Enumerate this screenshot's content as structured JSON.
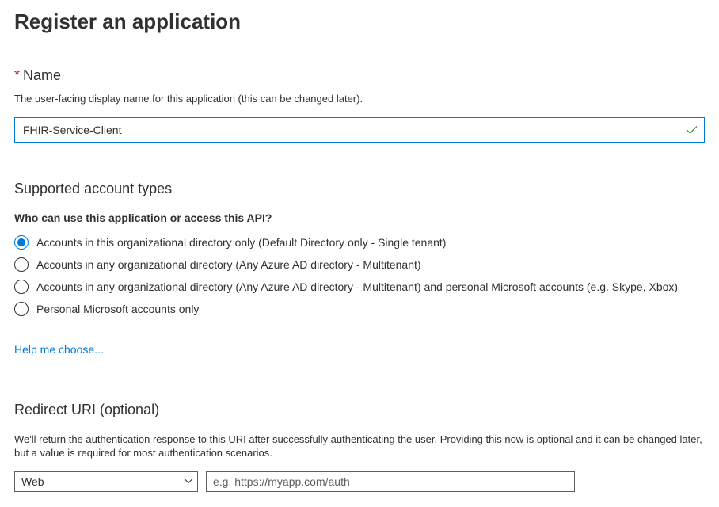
{
  "page": {
    "title": "Register an application"
  },
  "nameField": {
    "label": "Name",
    "hint": "The user-facing display name for this application (this can be changed later).",
    "value": "FHIR-Service-Client"
  },
  "accountTypes": {
    "heading": "Supported account types",
    "question": "Who can use this application or access this API?",
    "options": [
      {
        "label": "Accounts in this organizational directory only (Default Directory only - Single tenant)",
        "selected": true
      },
      {
        "label": "Accounts in any organizational directory (Any Azure AD directory - Multitenant)",
        "selected": false
      },
      {
        "label": "Accounts in any organizational directory (Any Azure AD directory - Multitenant) and personal Microsoft accounts (e.g. Skype, Xbox)",
        "selected": false
      },
      {
        "label": "Personal Microsoft accounts only",
        "selected": false
      }
    ],
    "helpLink": "Help me choose..."
  },
  "redirectUri": {
    "heading": "Redirect URI (optional)",
    "hint": "We'll return the authentication response to this URI after successfully authenticating the user. Providing this now is optional and it can be changed later, but a value is required for most authentication scenarios.",
    "platformSelected": "Web",
    "uriPlaceholder": "e.g. https://myapp.com/auth",
    "uriValue": ""
  }
}
